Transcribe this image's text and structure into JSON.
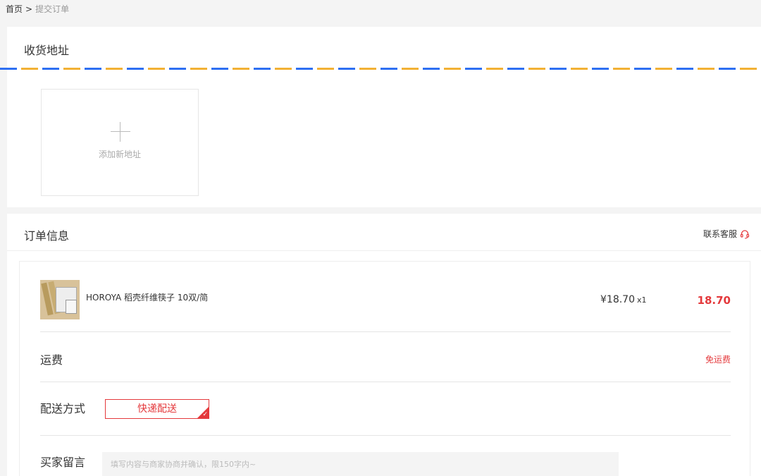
{
  "breadcrumb": {
    "home": "首页",
    "separator": ">",
    "current": "提交订单"
  },
  "address": {
    "title": "收货地址",
    "add_label": "添加新地址"
  },
  "order": {
    "title": "订单信息",
    "service_label": "联系客服",
    "service_icon": "headset-icon",
    "product": {
      "name": "HOROYA 稻壳纤维筷子 10双/简",
      "unit_price": "¥18.70",
      "quantity": "x1",
      "subtotal": "18.70"
    },
    "shipping_fee": {
      "label": "运费",
      "value": "免运费"
    },
    "delivery": {
      "label": "配送方式",
      "option": "快递配送"
    },
    "message": {
      "label": "买家留言",
      "placeholder": "填写内容与商家协商并确认，限150字内~"
    }
  },
  "colors": {
    "accent": "#e4393c",
    "stripe_blue": "#2e6ff2",
    "stripe_yellow": "#f2b134"
  }
}
